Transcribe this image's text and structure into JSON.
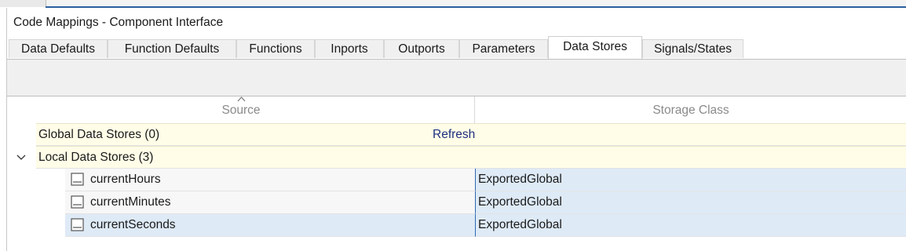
{
  "panel": {
    "title": "Code Mappings - Component Interface"
  },
  "tabs": [
    {
      "label": "Data Defaults",
      "active": false
    },
    {
      "label": "Function Defaults",
      "active": false
    },
    {
      "label": "Functions",
      "active": false
    },
    {
      "label": "Inports",
      "active": false
    },
    {
      "label": "Outports",
      "active": false
    },
    {
      "label": "Parameters",
      "active": false
    },
    {
      "label": "Data Stores",
      "active": true
    },
    {
      "label": "Signals/States",
      "active": false
    }
  ],
  "table": {
    "columns": {
      "source": "Source",
      "storage_class": "Storage Class"
    },
    "sorted_column": "Source",
    "groups": [
      {
        "label": "Global Data Stores (0)",
        "action_label": "Refresh"
      },
      {
        "label": "Local Data Stores (3)",
        "expanded": true
      }
    ],
    "rows": [
      {
        "source": "currentHours",
        "storage_class": "ExportedGlobal",
        "icon": "data-store-icon"
      },
      {
        "source": "currentMinutes",
        "storage_class": "ExportedGlobal",
        "icon": "data-store-icon"
      },
      {
        "source": "currentSeconds",
        "storage_class": "ExportedGlobal",
        "icon": "data-store-icon",
        "selected": true
      }
    ]
  },
  "colors": {
    "accent": "#2b5f9e",
    "group_row_bg": "#fffde7",
    "selection_bg": "#deeaf6",
    "link": "#1e2f80"
  }
}
